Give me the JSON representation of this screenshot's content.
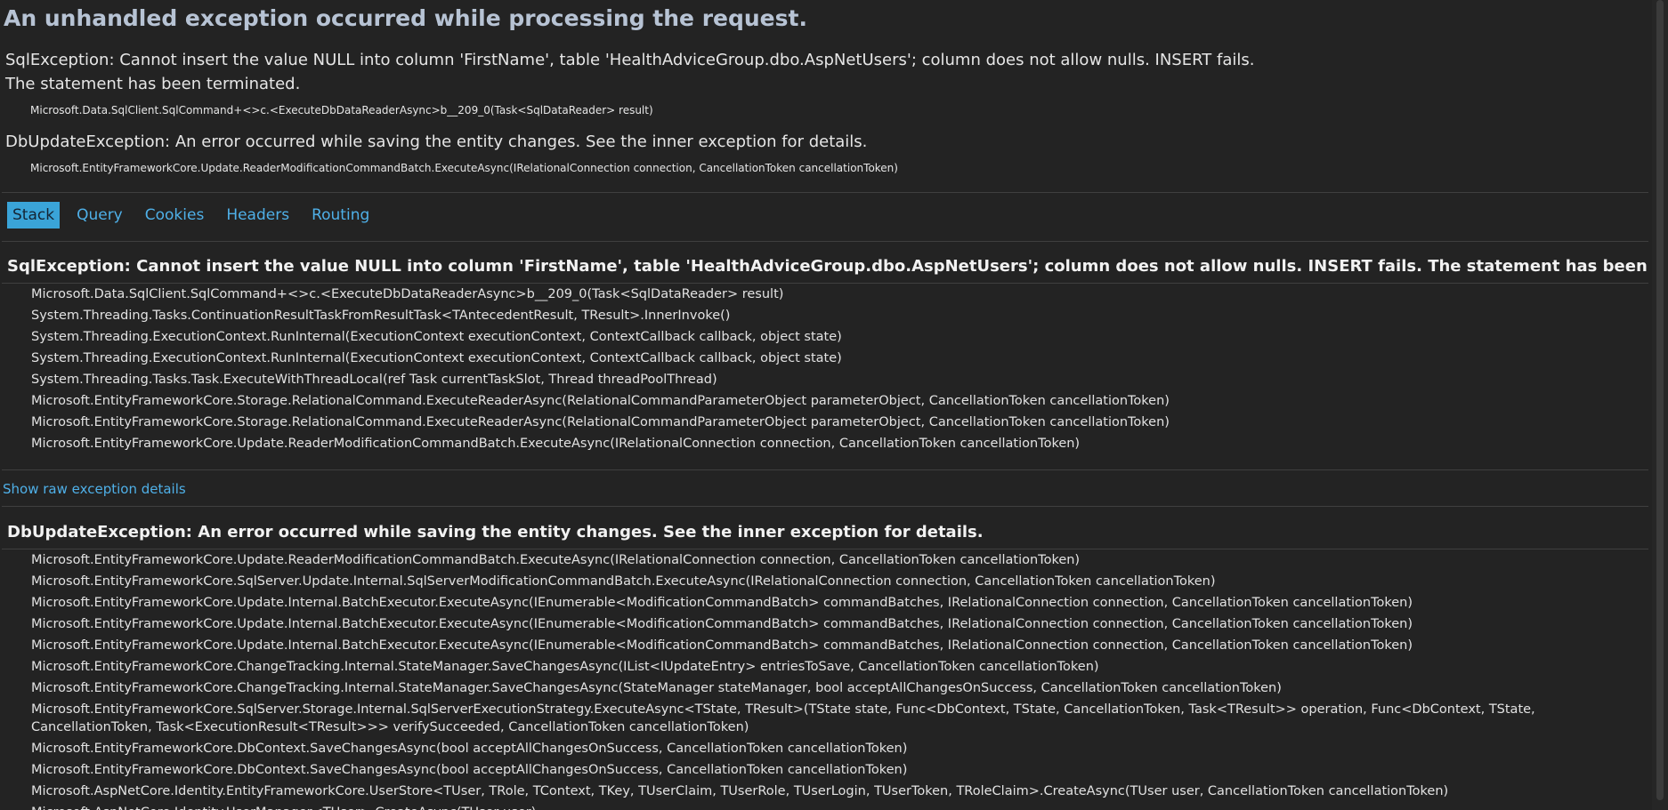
{
  "title": "An unhandled exception occurred while processing the request.",
  "summary": [
    {
      "message_line1": "SqlException: Cannot insert the value NULL into column 'FirstName', table 'HealthAdviceGroup.dbo.AspNetUsers'; column does not allow nulls. INSERT fails.",
      "message_line2": "The statement has been terminated.",
      "location": "Microsoft.Data.SqlClient.SqlCommand+<>c.<ExecuteDbDataReaderAsync>b__209_0(Task<SqlDataReader> result)"
    },
    {
      "message_line1": "DbUpdateException: An error occurred while saving the entity changes. See the inner exception for details.",
      "location": "Microsoft.EntityFrameworkCore.Update.ReaderModificationCommandBatch.ExecuteAsync(IRelationalConnection connection, CancellationToken cancellationToken)"
    }
  ],
  "tabs": [
    {
      "label": "Stack",
      "selected": true
    },
    {
      "label": "Query",
      "selected": false
    },
    {
      "label": "Cookies",
      "selected": false
    },
    {
      "label": "Headers",
      "selected": false
    },
    {
      "label": "Routing",
      "selected": false
    }
  ],
  "stack": [
    {
      "title": "SqlException: Cannot insert the value NULL into column 'FirstName', table 'HealthAdviceGroup.dbo.AspNetUsers'; column does not allow nulls. INSERT fails. The statement has been terminated.",
      "frames": [
        "Microsoft.Data.SqlClient.SqlCommand+<>c.<ExecuteDbDataReaderAsync>b__209_0(Task<SqlDataReader> result)",
        "System.Threading.Tasks.ContinuationResultTaskFromResultTask<TAntecedentResult, TResult>.InnerInvoke()",
        "System.Threading.ExecutionContext.RunInternal(ExecutionContext executionContext, ContextCallback callback, object state)",
        "System.Threading.ExecutionContext.RunInternal(ExecutionContext executionContext, ContextCallback callback, object state)",
        "System.Threading.Tasks.Task.ExecuteWithThreadLocal(ref Task currentTaskSlot, Thread threadPoolThread)",
        "Microsoft.EntityFrameworkCore.Storage.RelationalCommand.ExecuteReaderAsync(RelationalCommandParameterObject parameterObject, CancellationToken cancellationToken)",
        "Microsoft.EntityFrameworkCore.Storage.RelationalCommand.ExecuteReaderAsync(RelationalCommandParameterObject parameterObject, CancellationToken cancellationToken)",
        "Microsoft.EntityFrameworkCore.Update.ReaderModificationCommandBatch.ExecuteAsync(IRelationalConnection connection, CancellationToken cancellationToken)"
      ]
    },
    {
      "title": "DbUpdateException: An error occurred while saving the entity changes. See the inner exception for details.",
      "frames": [
        "Microsoft.EntityFrameworkCore.Update.ReaderModificationCommandBatch.ExecuteAsync(IRelationalConnection connection, CancellationToken cancellationToken)",
        "Microsoft.EntityFrameworkCore.SqlServer.Update.Internal.SqlServerModificationCommandBatch.ExecuteAsync(IRelationalConnection connection, CancellationToken cancellationToken)",
        "Microsoft.EntityFrameworkCore.Update.Internal.BatchExecutor.ExecuteAsync(IEnumerable<ModificationCommandBatch> commandBatches, IRelationalConnection connection, CancellationToken cancellationToken)",
        "Microsoft.EntityFrameworkCore.Update.Internal.BatchExecutor.ExecuteAsync(IEnumerable<ModificationCommandBatch> commandBatches, IRelationalConnection connection, CancellationToken cancellationToken)",
        "Microsoft.EntityFrameworkCore.Update.Internal.BatchExecutor.ExecuteAsync(IEnumerable<ModificationCommandBatch> commandBatches, IRelationalConnection connection, CancellationToken cancellationToken)",
        "Microsoft.EntityFrameworkCore.ChangeTracking.Internal.StateManager.SaveChangesAsync(IList<IUpdateEntry> entriesToSave, CancellationToken cancellationToken)",
        "Microsoft.EntityFrameworkCore.ChangeTracking.Internal.StateManager.SaveChangesAsync(StateManager stateManager, bool acceptAllChangesOnSuccess, CancellationToken cancellationToken)",
        "Microsoft.EntityFrameworkCore.SqlServer.Storage.Internal.SqlServerExecutionStrategy.ExecuteAsync<TState, TResult>(TState state, Func<DbContext, TState, CancellationToken, Task<TResult>> operation, Func<DbContext, TState, CancellationToken, Task<ExecutionResult<TResult>>> verifySucceeded, CancellationToken cancellationToken)",
        "Microsoft.EntityFrameworkCore.DbContext.SaveChangesAsync(bool acceptAllChangesOnSuccess, CancellationToken cancellationToken)",
        "Microsoft.EntityFrameworkCore.DbContext.SaveChangesAsync(bool acceptAllChangesOnSuccess, CancellationToken cancellationToken)",
        "Microsoft.AspNetCore.Identity.EntityFrameworkCore.UserStore<TUser, TRole, TContext, TKey, TUserClaim, TUserRole, TUserLogin, TUserToken, TRoleClaim>.CreateAsync(TUser user, CancellationToken cancellationToken)",
        "Microsoft.AspNetCore.Identity.UserManager<TUser>.CreateAsync(TUser user)"
      ]
    }
  ],
  "raw_link": "Show raw exception details",
  "colors": {
    "background": "#232323",
    "title": "#b7c3d4",
    "link": "#4fb0e8",
    "tab_selected_bg": "#3aa4d8"
  }
}
